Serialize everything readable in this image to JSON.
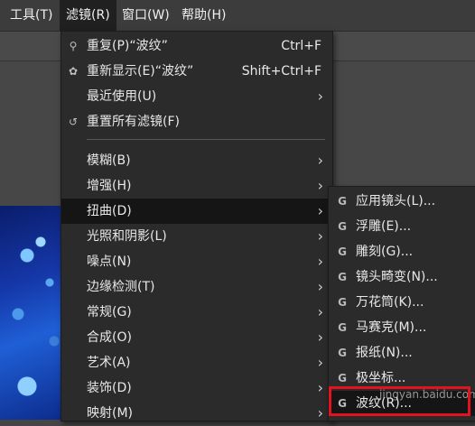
{
  "menubar": {
    "items": [
      {
        "label": "工具(T)",
        "active": false
      },
      {
        "label": "滤镜(R)",
        "active": true
      },
      {
        "label": "窗口(W)",
        "active": false
      },
      {
        "label": "帮助(H)",
        "active": false
      }
    ]
  },
  "filters_menu": {
    "repeat": {
      "label": "重复(P)“波纹”",
      "shortcut": "Ctrl+F",
      "icon": "repeat-filter-icon"
    },
    "reshow": {
      "label": "重新显示(E)“波纹”",
      "shortcut": "Shift+Ctrl+F",
      "icon": "reshow-filter-icon"
    },
    "recent": {
      "label": "最近使用(U)"
    },
    "reset": {
      "label": "重置所有滤镜(F)",
      "icon": "reset-icon"
    },
    "categories": [
      {
        "label": "模糊(B)"
      },
      {
        "label": "增强(H)"
      },
      {
        "label": "扭曲(D)",
        "highlighted": true
      },
      {
        "label": "光照和阴影(L)"
      },
      {
        "label": "噪点(N)"
      },
      {
        "label": "边缘检测(T)"
      },
      {
        "label": "常规(G)"
      },
      {
        "label": "合成(O)"
      },
      {
        "label": "艺术(A)"
      },
      {
        "label": "装饰(D)"
      },
      {
        "label": "映射(M)"
      }
    ],
    "submenu_arrow": "›"
  },
  "distort_menu": {
    "items": [
      {
        "label": "应用镜头(L)..."
      },
      {
        "label": "浮雕(E)..."
      },
      {
        "label": "雕刻(G)..."
      },
      {
        "label": "镜头畸变(N)..."
      },
      {
        "label": "万花筒(K)..."
      },
      {
        "label": "马赛克(M)..."
      },
      {
        "label": "报纸(N)..."
      },
      {
        "label": "极坐标..."
      },
      {
        "label": "波纹(R)...",
        "highlighted": true
      }
    ],
    "item_icon": "G"
  },
  "watermark": {
    "text": "jingyan.baidu.com"
  },
  "colors": {
    "highlight_box": "#e0141e",
    "menu_bg": "#2b2b2b"
  }
}
